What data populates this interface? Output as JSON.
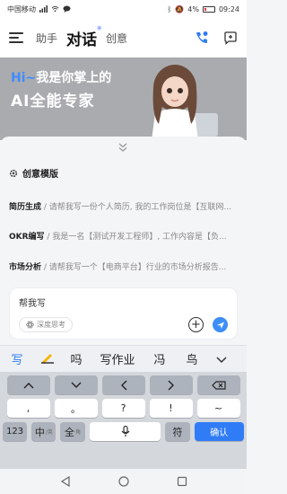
{
  "status_bar": {
    "carrier": "中国移动",
    "battery": "4%",
    "time": "09:24"
  },
  "header": {
    "tabs": [
      {
        "label": "助手"
      },
      {
        "label": "对话"
      },
      {
        "label": "创意"
      }
    ],
    "spark": "✳"
  },
  "banner": {
    "line1_hi": "Hi~",
    "line1_rest": "我是你掌上的",
    "line2": "AI全能专家"
  },
  "templates": {
    "title": "创意模版",
    "items": [
      {
        "name": "简历生成",
        "desc": "请帮我写一份个人简历, 我的工作岗位是【互联网..."
      },
      {
        "name": "OKR编写",
        "desc": "我是一名【测试开发工程师】, 工作内容是【负..."
      },
      {
        "name": "市场分析",
        "desc": "请帮我写一个【电商平台】行业的市场分析报告..."
      }
    ]
  },
  "input": {
    "value": "帮我写",
    "deep_think_label": "深度思考"
  },
  "suggestions": [
    "写",
    "吗",
    "写作业",
    "冯",
    "鸟"
  ],
  "keyboard": {
    "row2": [
      ",",
      "。",
      "?",
      "!",
      "~"
    ],
    "num_label": "123",
    "zh_label": "中",
    "zh_sub": "/英",
    "full_label": "全",
    "full_sub": "角",
    "symbol_label": "符",
    "confirm_label": "确认"
  },
  "colors": {
    "accent": "#2f7cf6",
    "send": "#3e8ef7"
  }
}
